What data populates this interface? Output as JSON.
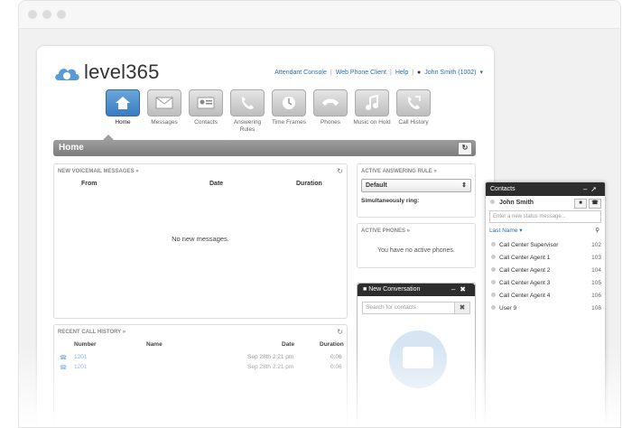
{
  "header": {
    "logo_text": "level365",
    "links": [
      "Attendant Console",
      "Web Phone Client",
      "Help"
    ],
    "user": "John Smith (1002)"
  },
  "nav": [
    {
      "label": "Home",
      "icon": "home-icon"
    },
    {
      "label": "Messages",
      "icon": "envelope-icon"
    },
    {
      "label": "Contacts",
      "icon": "contacts-card-icon"
    },
    {
      "label": "Answering Rules",
      "icon": "phone-rules-icon"
    },
    {
      "label": "Time Frames",
      "icon": "clock-icon"
    },
    {
      "label": "Phones",
      "icon": "handset-icon"
    },
    {
      "label": "Music on Hold",
      "icon": "music-note-icon"
    },
    {
      "label": "Call History",
      "icon": "call-history-icon"
    }
  ],
  "page_title": "Home",
  "voicemail": {
    "title": "NEW VOICEMAIL MESSAGES »",
    "columns": [
      "From",
      "Date",
      "Duration"
    ],
    "empty": "No new messages."
  },
  "answering_rule": {
    "title": "ACTIVE ANSWERING RULE »",
    "selected": "Default",
    "simultaneous": "Simultaneously ring:"
  },
  "active_phones": {
    "title": "ACTIVE PHONES »",
    "empty": "You have no active phones."
  },
  "conversation": {
    "title": "New Conversation",
    "search_placeholder": "Search for contacts"
  },
  "call_history": {
    "title": "RECENT CALL HISTORY »",
    "columns": [
      "Number",
      "Name",
      "Date",
      "Duration"
    ],
    "rows": [
      {
        "number": "1201",
        "name": "",
        "date": "Sep 28th 2:21 pm",
        "duration": "0:06"
      },
      {
        "number": "1201",
        "name": "",
        "date": "Sep 28th 2:21 pm",
        "duration": "0:06"
      }
    ]
  },
  "contacts": {
    "title": "Contacts",
    "user": "John Smith",
    "status_placeholder": "Enter a new status message...",
    "sort_label": "Last Name",
    "list": [
      {
        "name": "Call Center Supervisor",
        "ext": "102"
      },
      {
        "name": "Call Center Agent 1",
        "ext": "103"
      },
      {
        "name": "Call Center Agent 2",
        "ext": "104"
      },
      {
        "name": "Call Center Agent 3",
        "ext": "105"
      },
      {
        "name": "Call Center Agent 4",
        "ext": "106"
      },
      {
        "name": "User 9",
        "ext": "108"
      }
    ]
  },
  "colors": {
    "accent": "#3a7cc0",
    "dark_header": "#2d2d2d",
    "link": "#2a6db8"
  }
}
